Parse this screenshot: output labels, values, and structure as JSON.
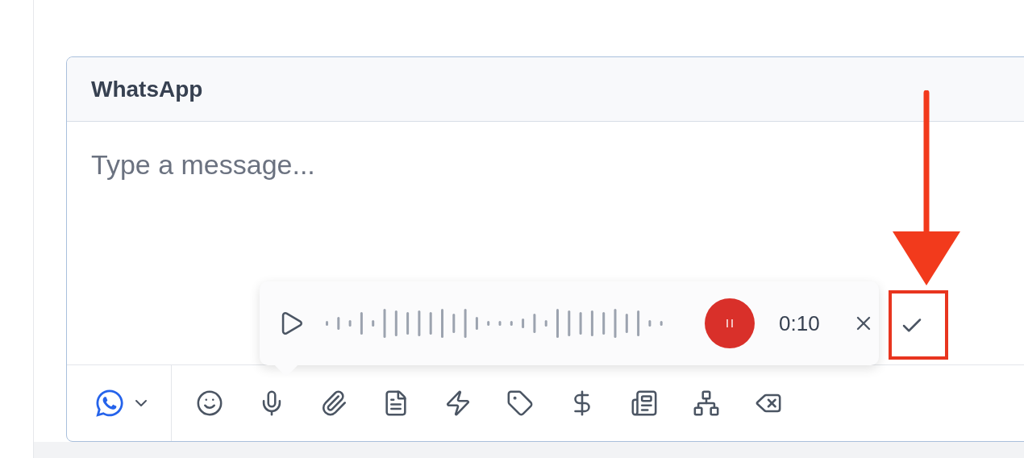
{
  "composer": {
    "channel": "WhatsApp",
    "message": {
      "placeholder": "Type a message..."
    },
    "recorder": {
      "elapsed": "0:10"
    }
  }
}
